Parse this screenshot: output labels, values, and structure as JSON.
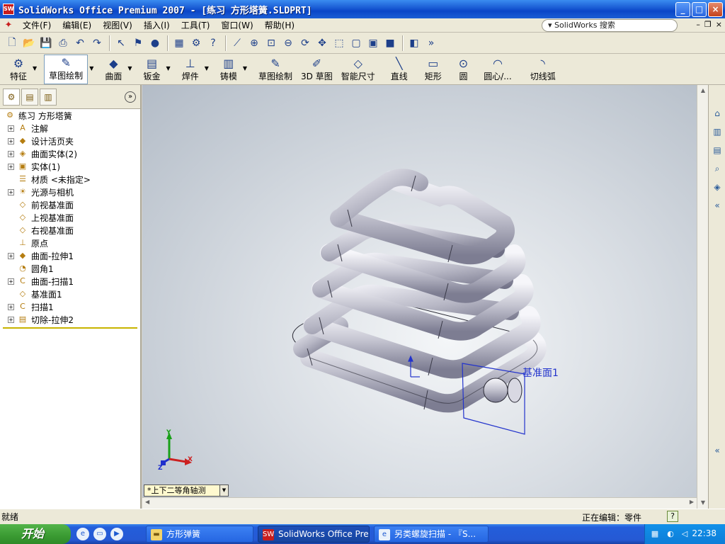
{
  "window": {
    "title": "SolidWorks Office Premium 2007 - [练习 方形塔簧.SLDPRT]",
    "app_icon_label": "SW",
    "controls": [
      "_",
      "□",
      "×"
    ]
  },
  "menubar": {
    "items": [
      "文件(F)",
      "编辑(E)",
      "视图(V)",
      "插入(I)",
      "工具(T)",
      "窗口(W)",
      "帮助(H)"
    ],
    "search_placeholder": "SolidWorks 搜索",
    "mdi_controls": [
      "–",
      "❐",
      "×"
    ]
  },
  "command_manager": {
    "tabs": [
      {
        "label": "特征",
        "icon": "feature-icon"
      },
      {
        "label": "草图绘制",
        "icon": "sketch-icon",
        "active": true
      },
      {
        "label": "曲面",
        "icon": "surface-icon"
      },
      {
        "label": "钣金",
        "icon": "sheetmetal-icon"
      },
      {
        "label": "焊件",
        "icon": "weldment-icon"
      },
      {
        "label": "铸模",
        "icon": "mold-icon"
      }
    ],
    "tools": [
      {
        "label": "草图绘制",
        "icon": "sketch-icon"
      },
      {
        "label": "3D 草图",
        "icon": "3d-sketch-icon"
      },
      {
        "label": "智能尺寸",
        "icon": "smart-dimension-icon"
      },
      {
        "label": "直线",
        "icon": "line-icon"
      },
      {
        "label": "矩形",
        "icon": "rectangle-icon"
      },
      {
        "label": "圆",
        "icon": "circle-icon"
      },
      {
        "label": "圆心/...",
        "icon": "centerpoint-arc-icon"
      },
      {
        "label": "切线弧",
        "icon": "tangent-arc-icon"
      }
    ]
  },
  "feature_tree": {
    "root": "练习 方形塔簧",
    "items": [
      {
        "label": "注解",
        "icon": "annotations-icon",
        "expandable": true
      },
      {
        "label": "设计活页夹",
        "icon": "design-binder-icon",
        "expandable": true
      },
      {
        "label": "曲面实体(2)",
        "icon": "surface-bodies-icon",
        "expandable": true
      },
      {
        "label": "实体(1)",
        "icon": "solid-bodies-icon",
        "expandable": true
      },
      {
        "label": "材质 <未指定>",
        "icon": "material-icon",
        "expandable": false
      },
      {
        "label": "光源与相机",
        "icon": "lights-cameras-icon",
        "expandable": true
      },
      {
        "label": "前视基准面",
        "icon": "plane-icon",
        "expandable": false
      },
      {
        "label": "上视基准面",
        "icon": "plane-icon",
        "expandable": false
      },
      {
        "label": "右视基准面",
        "icon": "plane-icon",
        "expandable": false
      },
      {
        "label": "原点",
        "icon": "origin-icon",
        "expandable": false
      },
      {
        "label": "曲面-拉伸1",
        "icon": "surface-extrude-icon",
        "expandable": true
      },
      {
        "label": "圆角1",
        "icon": "fillet-icon",
        "expandable": false
      },
      {
        "label": "曲面-扫描1",
        "icon": "surface-sweep-icon",
        "expandable": true
      },
      {
        "label": "基准面1",
        "icon": "plane-icon",
        "expandable": false
      },
      {
        "label": "扫描1",
        "icon": "sweep-icon",
        "expandable": true
      },
      {
        "label": "切除-拉伸2",
        "icon": "cut-extrude-icon",
        "expandable": true
      }
    ]
  },
  "viewport": {
    "plane_label": "基准面1",
    "triad": {
      "x": "X",
      "y": "Y",
      "z": "Z"
    },
    "view_orientation": "*上下二等角轴测"
  },
  "statusbar": {
    "left": "就绪",
    "right": "正在编辑：零件",
    "help": "?"
  },
  "taskbar": {
    "start": "开始",
    "tasks": [
      {
        "label": "方形弹簧",
        "icon": "folder-icon",
        "active": false
      },
      {
        "label": "SolidWorks Office Pre...",
        "icon": "solidworks-icon",
        "active": true
      },
      {
        "label": "另类螺旋扫描 - 『S...",
        "icon": "browser-icon",
        "active": false
      }
    ],
    "clock": "22:38"
  },
  "colors": {
    "titlebar": "#0a46c8",
    "chrome": "#ece9d8",
    "plane_line": "#2233cc",
    "plane_label": "#2233cc"
  }
}
